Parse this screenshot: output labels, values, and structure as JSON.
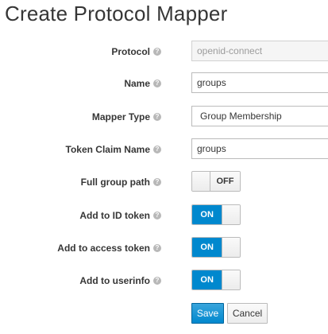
{
  "page": {
    "title": "Create Protocol Mapper"
  },
  "form": {
    "protocol": {
      "label": "Protocol",
      "value": "openid-connect"
    },
    "name": {
      "label": "Name",
      "value": "groups"
    },
    "mapper_type": {
      "label": "Mapper Type",
      "value": "Group Membership"
    },
    "token_claim_name": {
      "label": "Token Claim Name",
      "value": "groups"
    },
    "full_group_path": {
      "label": "Full group path",
      "state": "OFF"
    },
    "add_to_id_token": {
      "label": "Add to ID token",
      "state": "ON"
    },
    "add_to_access_token": {
      "label": "Add to access token",
      "state": "ON"
    },
    "add_to_userinfo": {
      "label": "Add to userinfo",
      "state": "ON"
    }
  },
  "help_icon": {
    "glyph": "?",
    "icon": "question-circle-icon"
  },
  "actions": {
    "save_label": "Save",
    "cancel_label": "Cancel"
  },
  "colors": {
    "primary": "#0088ce",
    "text": "#363636",
    "input_border": "#bbbbbb"
  }
}
